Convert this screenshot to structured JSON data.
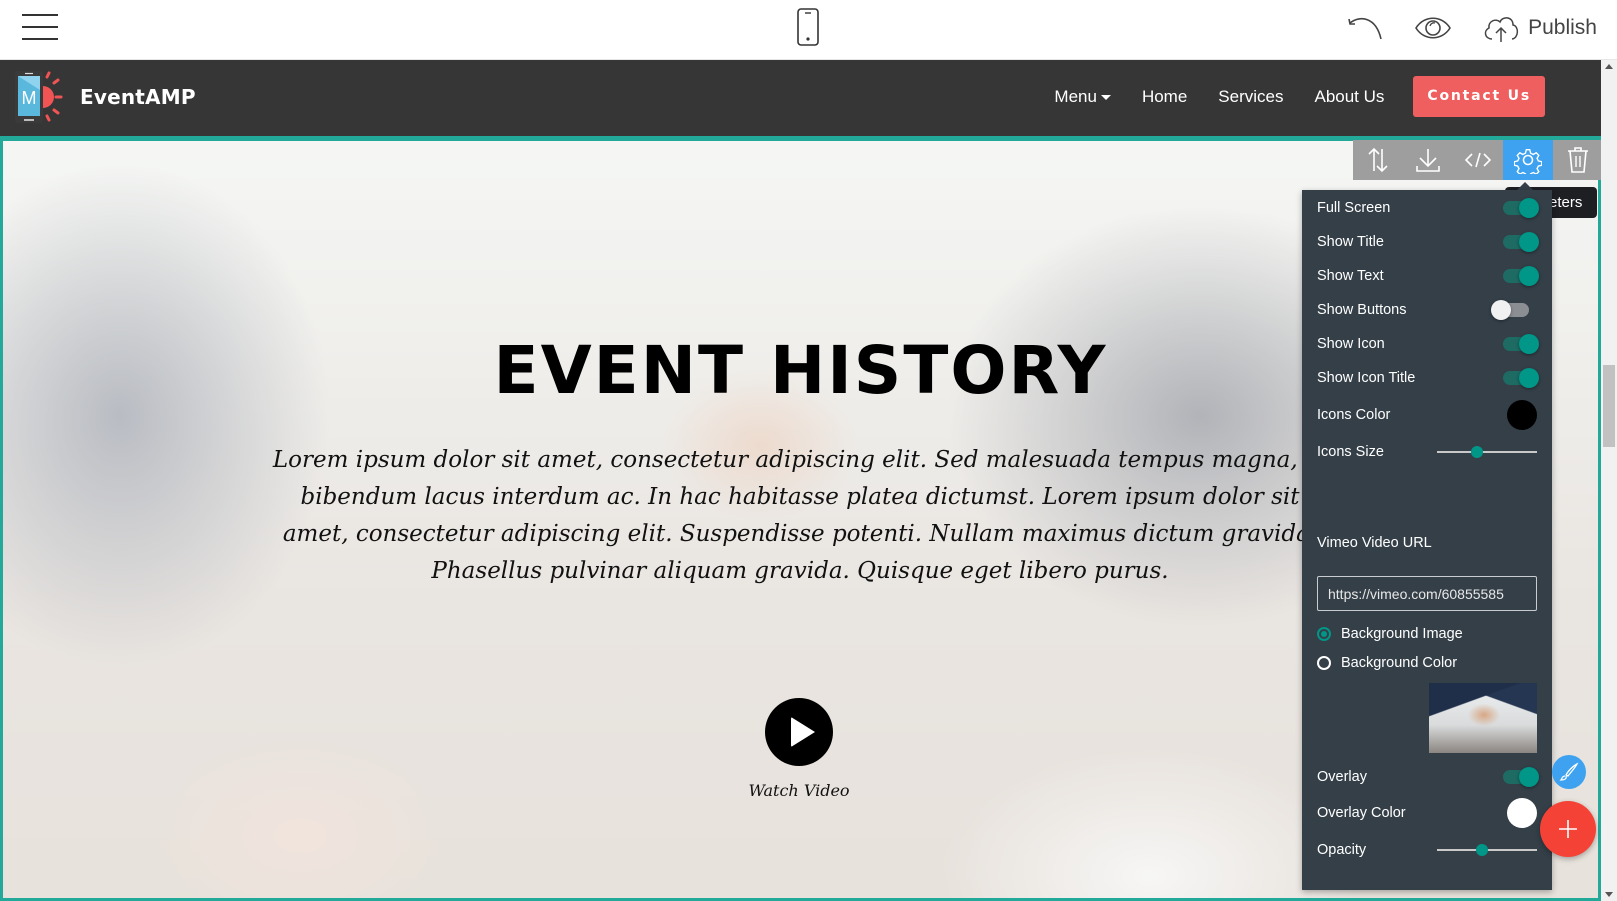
{
  "editor": {
    "menu_icon": "hamburger-icon",
    "device_icon": "mobile-phone-icon",
    "undo_icon": "undo-icon",
    "preview_icon": "eye-icon",
    "publish_icon": "cloud-upload-icon",
    "publish_label": "Publish"
  },
  "site": {
    "brand": {
      "name": "EventAMP",
      "logo_letter": "M"
    },
    "nav": {
      "items": [
        {
          "label": "Menu",
          "has_dropdown": true
        },
        {
          "label": "Home"
        },
        {
          "label": "Services"
        },
        {
          "label": "About Us"
        }
      ],
      "cta_label": "Contact Us"
    },
    "hero": {
      "title": "EVENT HISTORY",
      "text": "Lorem ipsum dolor sit amet, consectetur adipiscing elit. Sed malesuada tempus magna, id bibendum lacus interdum ac. In hac habitasse platea dictumst. Lorem ipsum dolor sit amet, consectetur adipiscing elit. Suspendisse potenti. Nullam maximus dictum gravida. Phasellus pulvinar aliquam gravida. Quisque eget libero purus.",
      "video_label": "Watch Video"
    }
  },
  "block_toolbar": {
    "buttons": [
      {
        "name": "move",
        "icon": "reorder-arrows-icon"
      },
      {
        "name": "save",
        "icon": "download-icon"
      },
      {
        "name": "code",
        "icon": "code-icon"
      },
      {
        "name": "parameters",
        "icon": "gear-icon",
        "active": true
      },
      {
        "name": "delete",
        "icon": "trash-icon"
      }
    ],
    "tooltip": "Parameters",
    "tooltip_visible": "eters"
  },
  "panel": {
    "toggles": [
      {
        "label": "Full Screen",
        "on": true
      },
      {
        "label": "Show Title",
        "on": true
      },
      {
        "label": "Show Text",
        "on": true
      },
      {
        "label": "Show Buttons",
        "on": false
      },
      {
        "label": "Show Icon",
        "on": true
      },
      {
        "label": "Show Icon Title",
        "on": true
      }
    ],
    "icons_color": {
      "label": "Icons Color",
      "value": "#000000"
    },
    "icons_size": {
      "label": "Icons Size",
      "value_fraction": 0.4
    },
    "vimeo": {
      "label": "Vimeo Video URL",
      "value": "https://vimeo.com/60855585"
    },
    "background": {
      "options": [
        {
          "label": "Background Image",
          "checked": true
        },
        {
          "label": "Background Color",
          "checked": false
        }
      ]
    },
    "overlay": {
      "label": "Overlay",
      "on": true
    },
    "overlay_color": {
      "label": "Overlay Color",
      "value": "#ffffff"
    },
    "opacity": {
      "label": "Opacity",
      "value_fraction": 0.45
    }
  },
  "colors": {
    "accent": "#009688",
    "active_blue": "#3ea2f0",
    "cta_red": "#f05f5f",
    "fab_red": "#f44336",
    "panel_bg": "#343f48",
    "navbar_bg": "#363636",
    "block_border": "#22a99a"
  },
  "fabs": {
    "brush_icon": "paint-brush-icon",
    "add_icon": "plus-icon"
  }
}
